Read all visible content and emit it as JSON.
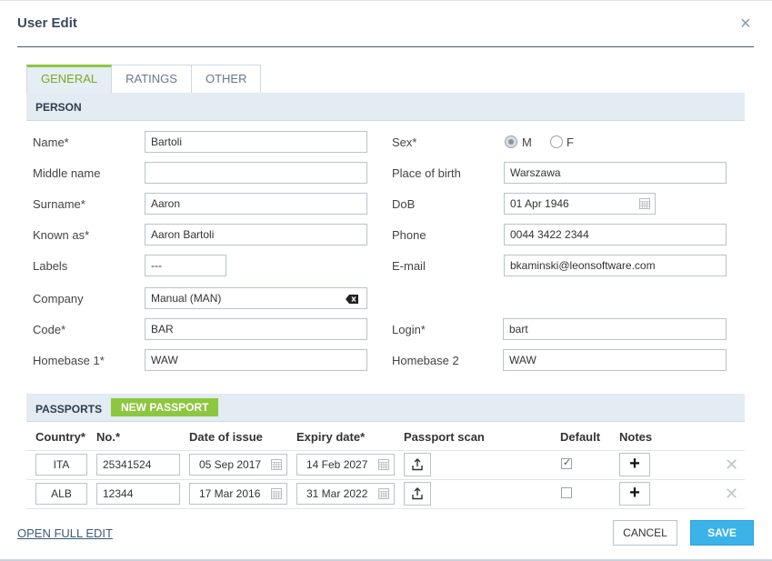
{
  "dialog": {
    "title": "User Edit",
    "close_icon": "×"
  },
  "tabs": [
    {
      "label": "GENERAL",
      "active": true
    },
    {
      "label": "RATINGS",
      "active": false
    },
    {
      "label": "OTHER",
      "active": false
    }
  ],
  "person": {
    "section_title": "PERSON",
    "name": {
      "label": "Name*",
      "value": "Bartoli"
    },
    "middle_name": {
      "label": "Middle name",
      "value": ""
    },
    "surname": {
      "label": "Surname*",
      "value": "Aaron"
    },
    "known_as": {
      "label": "Known as*",
      "value": "Aaron Bartoli"
    },
    "labels": {
      "label": "Labels",
      "value": "---"
    },
    "company": {
      "label": "Company",
      "value": "Manual (MAN)"
    },
    "code": {
      "label": "Code*",
      "value": "BAR"
    },
    "homebase1": {
      "label": "Homebase 1*",
      "value": "WAW"
    },
    "sex": {
      "label": "Sex*",
      "options": [
        "M",
        "F"
      ],
      "selected": "M"
    },
    "place_of_birth": {
      "label": "Place of birth",
      "value": "Warszawa"
    },
    "dob": {
      "label": "DoB",
      "value": "01 Apr 1946"
    },
    "phone": {
      "label": "Phone",
      "value": "0044 3422 2344"
    },
    "email": {
      "label": "E-mail",
      "value": "bkaminski@leonsoftware.com"
    },
    "login": {
      "label": "Login*",
      "value": "bart"
    },
    "homebase2": {
      "label": "Homebase 2",
      "value": "WAW"
    }
  },
  "passports": {
    "section_title": "PASSPORTS",
    "new_button": "NEW PASSPORT",
    "columns": [
      "Country*",
      "No.*",
      "Date of issue",
      "Expiry date*",
      "Passport scan",
      "Default",
      "Notes"
    ],
    "rows": [
      {
        "country": "ITA",
        "number": "25341524",
        "issue": "05 Sep 2017",
        "expiry": "14 Feb 2027",
        "default": true
      },
      {
        "country": "ALB",
        "number": "12344",
        "issue": "17 Mar 2016",
        "expiry": "31 Mar 2022",
        "default": false
      }
    ]
  },
  "footer": {
    "open_full_edit": "OPEN FULL EDIT",
    "cancel": "CANCEL",
    "save": "SAVE"
  },
  "colors": {
    "accent_green": "#8dc63f",
    "save_blue": "#3bb3e8",
    "section_bg": "#e3ebf3"
  },
  "icons": {
    "calendar": "calendar-icon",
    "upload": "upload-icon",
    "clear": "clear-input-icon",
    "add_note": "plus-icon",
    "remove_row": "close-icon"
  }
}
